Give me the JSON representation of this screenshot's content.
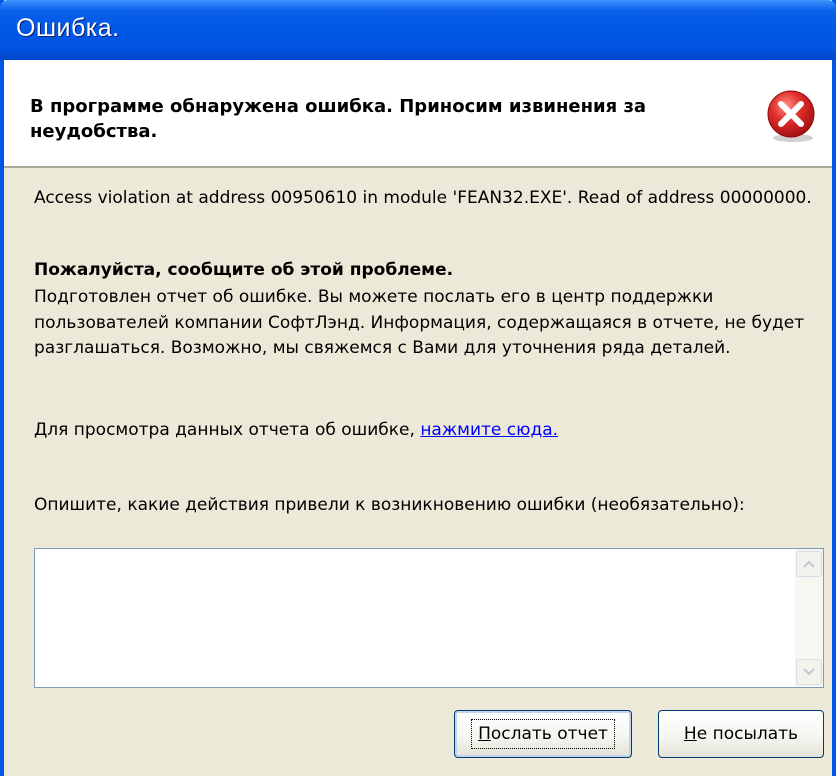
{
  "window": {
    "title": "Ошибка."
  },
  "header": {
    "message": "В программе обнаружена ошибка. Приносим извинения за неудобства.",
    "icon": "error-icon",
    "icon_color": "#D4232B"
  },
  "body": {
    "error_text": "Access violation at address 00950610 in module 'FEAN32.EXE'. Read of address 00000000.",
    "report_heading": "Пожалуйста, сообщите об этой проблеме.",
    "report_text": "Подготовлен отчет об ошибке. Вы можете послать его в центр поддержки пользователей компании СофтЛэнд. Информация, содержащаяся в отчете, не будет разглашаться. Возможно, мы свяжемся с Вами для уточнения ряда деталей.",
    "view_prefix": "Для просмотра данных отчета об ошибке, ",
    "view_link": "нажмите сюда.",
    "describe_label": "Опишите, какие действия привели к возникновению ошибки (необязательно):",
    "describe_value": ""
  },
  "buttons": {
    "send_first": "П",
    "send_rest": "ослать отчет",
    "cancel_first": "Н",
    "cancel_rest": "е посылать"
  },
  "colors": {
    "titlebar": "#0058E6",
    "dialog_bg": "#ECE9D8",
    "link": "#0000FF"
  }
}
